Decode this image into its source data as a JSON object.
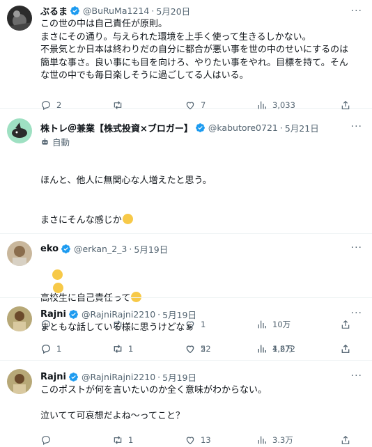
{
  "tweets": [
    {
      "name": "ぶるま",
      "handle": "@BuRuMa1214",
      "dot": "·",
      "date": "5月20日",
      "lines": [
        "この世の中は自己責任が原則。",
        "まさにその通り。与えられた環境を上手く使って生きるしかない。",
        "不景気とか日本は終わりだの自分に都合が悪い事を世の中のせいにするのは",
        "簡単な事さ。良い事にも目を向けろ、やりたい事をやれ。目標を持て。そん",
        "な世の中でも毎日楽しそうに過ごしてる人はいる。"
      ],
      "replies": "2",
      "retweets": "",
      "likes": "7",
      "views": "3,033"
    },
    {
      "name": "株トレ＠兼業【株式投資×ブロガー】",
      "handle": "@kabutore0721",
      "dot": "·",
      "date": "5月21日",
      "auto_label": "自動",
      "lines": [
        "ほんと、他人に無関心な人増えたと思う。",
        "まさにそんな感じか",
        "",
        "高校生に自己責任って"
      ],
      "replies": "1",
      "retweets": "",
      "likes": "5",
      "views": "1,272"
    },
    {
      "name": "eko",
      "handle": "@erkan_2_3",
      "dot": "·",
      "date": "5月19日",
      "lines": [],
      "emoji": [
        "thinking-face",
        "thinking-face"
      ],
      "replies": "",
      "retweets": "",
      "likes": "1",
      "views": "10万"
    },
    {
      "name": "Rajni",
      "handle": "@RajniRajni2210",
      "dot": "·",
      "date": "5月19日",
      "lines": [
        "まともな話している様に思うけどなぁ"
      ],
      "replies": "",
      "retweets": "1",
      "likes": "22",
      "views": "4.6万"
    },
    {
      "name": "Rajni",
      "handle": "@RajniRajni2210",
      "dot": "·",
      "date": "5月19日",
      "lines": [
        "このポストが何を言いたいのか全く意味がわからない。",
        "",
        "泣いてて可哀想だよね〜ってこと？"
      ],
      "replies": "",
      "retweets": "1",
      "likes": "13",
      "views": "3.3万"
    }
  ],
  "colors": {
    "verified": "#1d9bf0",
    "muted": "#536471",
    "text": "#0f1419",
    "divider": "#eff3f4"
  },
  "icons": [
    "reply-icon",
    "retweet-icon",
    "like-icon",
    "views-icon",
    "share-icon",
    "more-icon",
    "verified-badge-icon",
    "robot-icon"
  ]
}
